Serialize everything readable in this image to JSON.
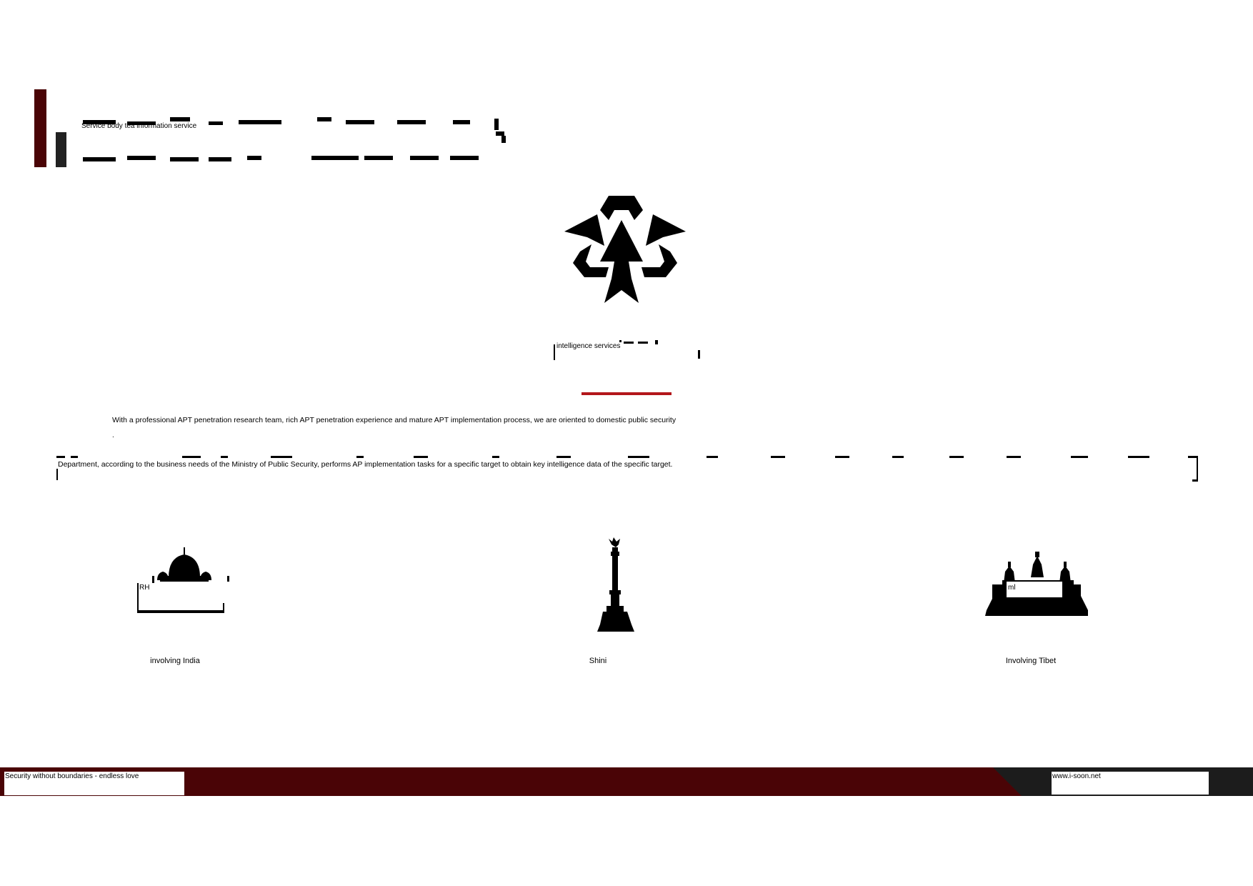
{
  "header": {
    "section_title": "Service body tea information service"
  },
  "service": {
    "title": "intelligence services",
    "intro_line": "With a professional APT penetration research team, rich APT penetration experience and mature APT implementation process, we are oriented to domestic public security",
    "intro_continuation": ".",
    "body_line": "Department, according to the business needs of the Ministry of Public Security, performs AP implementation tasks for a specific target to obtain key intelligence data of the specific target."
  },
  "regions": [
    {
      "label": "involving India",
      "icon": "mosque-icon",
      "caption": "RH"
    },
    {
      "label": "Shini",
      "icon": "monument-column-icon",
      "caption": ""
    },
    {
      "label": "Involving Tibet",
      "icon": "temple-icon",
      "caption": "ml"
    }
  ],
  "footer": {
    "slogan": "Security without boundaries - endless love",
    "url": "www.i-soon.net"
  },
  "colors": {
    "accent_dark_red": "#4a0406",
    "accent_red": "#b3171b",
    "dark_gray": "#222222"
  }
}
